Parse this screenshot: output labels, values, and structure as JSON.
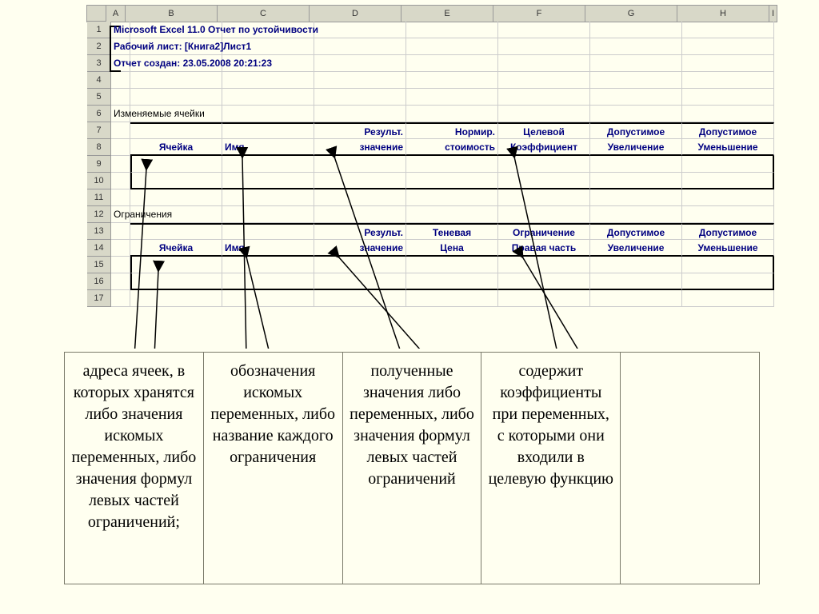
{
  "columns": [
    "A",
    "B",
    "C",
    "D",
    "E",
    "F",
    "G",
    "H",
    "I"
  ],
  "rows": [
    "1",
    "2",
    "3",
    "4",
    "5",
    "6",
    "7",
    "8",
    "9",
    "10",
    "11",
    "12",
    "13",
    "14",
    "15",
    "16",
    "17"
  ],
  "report": {
    "title": "Microsoft Excel 11.0 Отчет по устойчивости",
    "worksheet": "Рабочий лист: [Книга2]Лист1",
    "created": "Отчет создан: 23.05.2008 20:21:23",
    "section1": "Изменяемые ячейки",
    "section2": "Ограничения",
    "headers1": {
      "B": "Ячейка",
      "C": "Имя",
      "D_top": "Результ.",
      "D_bot": "значение",
      "E_top": "Нормир.",
      "E_bot": "стоимость",
      "F_top": "Целевой",
      "F_bot": "Коэффициент",
      "G_top": "Допустимое",
      "G_bot": "Увеличение",
      "H_top": "Допустимое",
      "H_bot": "Уменьшение"
    },
    "headers2": {
      "B": "Ячейка",
      "C": "Имя",
      "D_top": "Результ.",
      "D_bot": "значение",
      "E_top": "Теневая",
      "E_bot": "Цена",
      "F_top": "Ограничение",
      "F_bot": "Правая часть",
      "G_top": "Допустимое",
      "G_bot": "Увеличение",
      "H_top": "Допустимое",
      "H_bot": "Уменьшение"
    }
  },
  "explain": {
    "c1": "адреса ячеек, в которых хранятся либо значения искомых переменных, либо значения формул левых частей ограничений;",
    "c2": "обозначения искомых переменных, либо название каждого ограничения",
    "c3": "полученные значения либо переменных, либо значения формул левых частей ограничений",
    "c4": "содержит коэффициенты при переменных, с которыми они входили в целевую функцию",
    "c5": ""
  }
}
